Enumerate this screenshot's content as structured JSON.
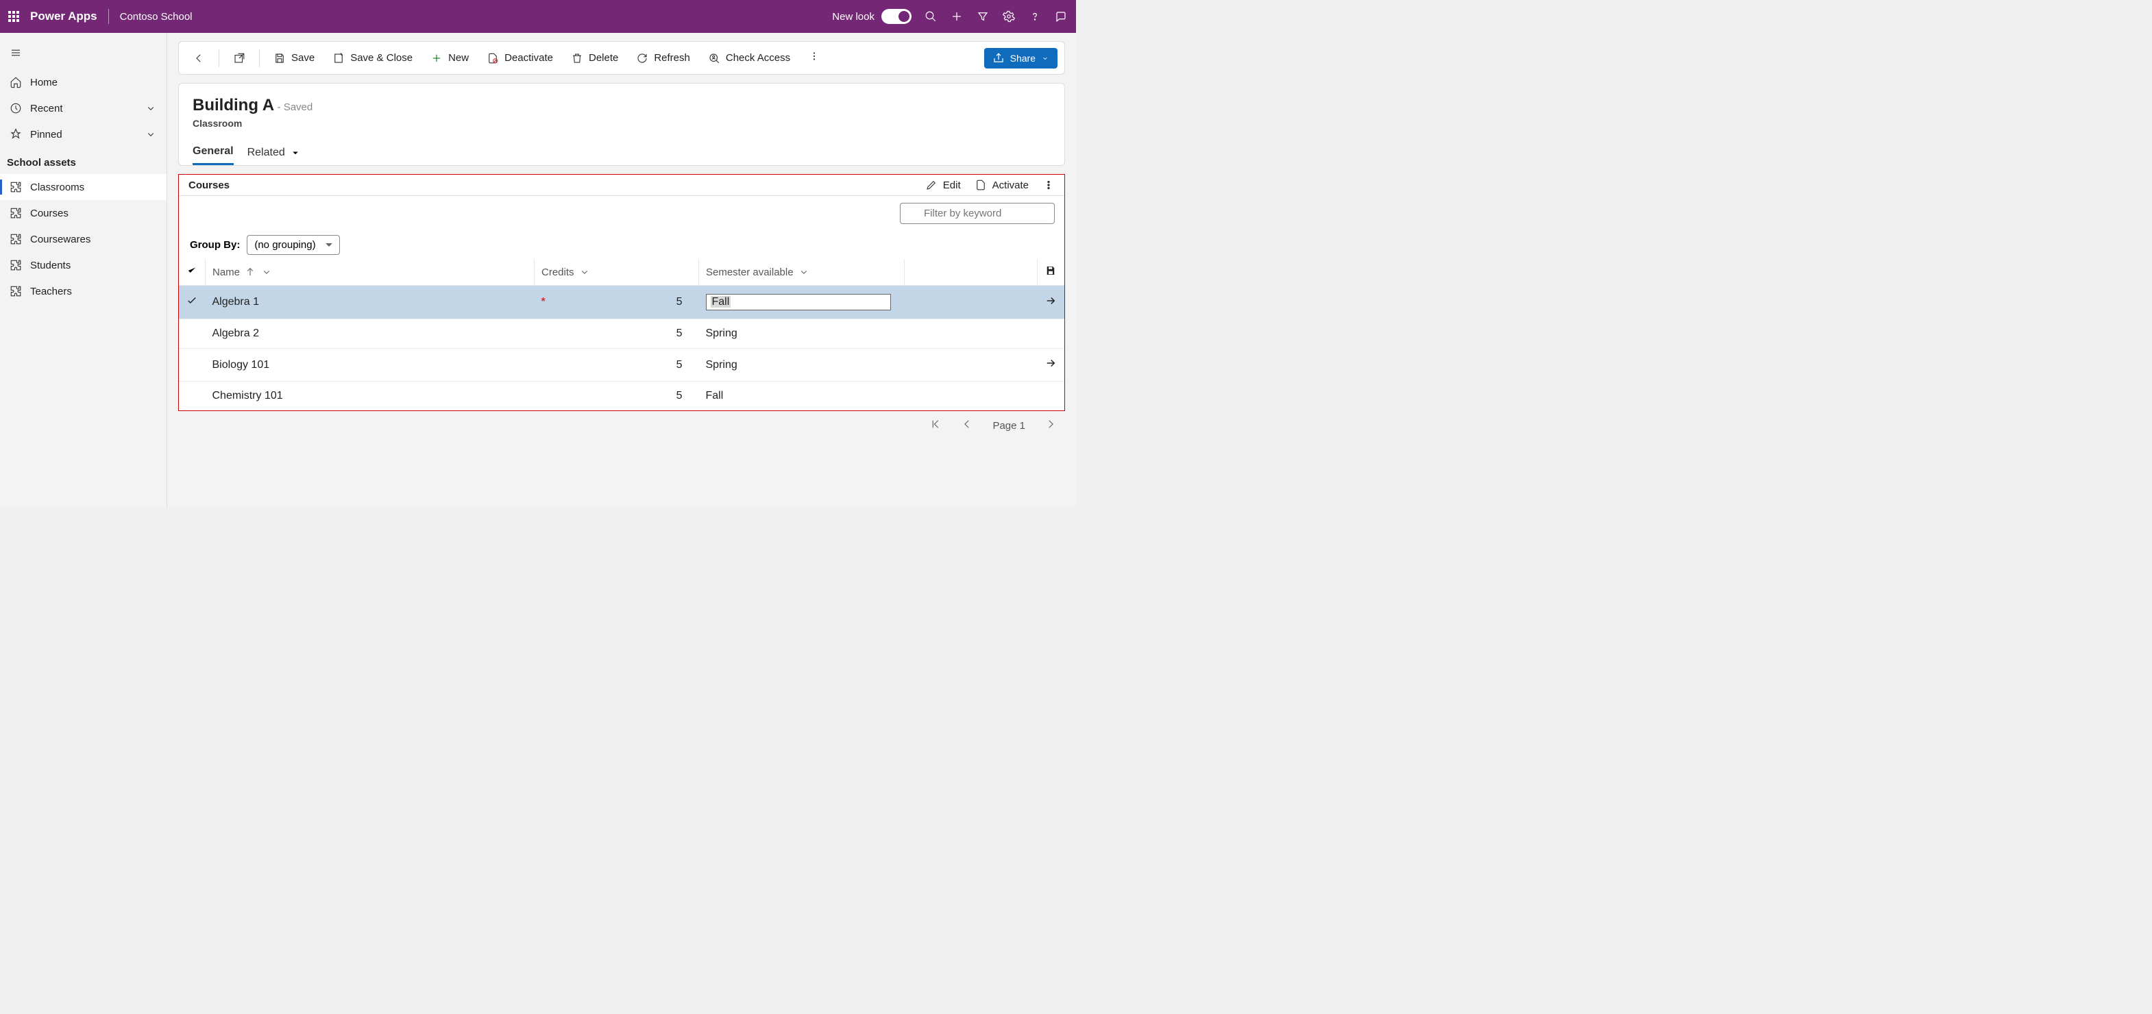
{
  "header": {
    "brand": "Power Apps",
    "org": "Contoso School",
    "new_look_label": "New look"
  },
  "sidebar": {
    "home": "Home",
    "recent": "Recent",
    "pinned": "Pinned",
    "group_title": "School assets",
    "items": [
      "Classrooms",
      "Courses",
      "Coursewares",
      "Students",
      "Teachers"
    ]
  },
  "commands": {
    "save": "Save",
    "save_close": "Save & Close",
    "new": "New",
    "deactivate": "Deactivate",
    "delete": "Delete",
    "refresh": "Refresh",
    "check_access": "Check Access",
    "share": "Share"
  },
  "record": {
    "title": "Building A",
    "saved": "- Saved",
    "entity": "Classroom",
    "tabs": {
      "general": "General",
      "related": "Related"
    }
  },
  "subgrid": {
    "title": "Courses",
    "edit": "Edit",
    "activate": "Activate",
    "filter_placeholder": "Filter by keyword",
    "groupby_label": "Group By:",
    "groupby_value": "(no grouping)",
    "columns": {
      "name": "Name",
      "credits": "Credits",
      "semester": "Semester available"
    },
    "edit_semester_value": "Fall",
    "rows": [
      {
        "name": "Algebra 1",
        "credits": "5",
        "semester": "Fall",
        "selected": true,
        "editing": true,
        "arrow": true,
        "required": true
      },
      {
        "name": "Algebra 2",
        "credits": "5",
        "semester": "Spring",
        "selected": false,
        "editing": false,
        "arrow": false
      },
      {
        "name": "Biology 101",
        "credits": "5",
        "semester": "Spring",
        "selected": false,
        "editing": false,
        "arrow": true
      },
      {
        "name": "Chemistry 101",
        "credits": "5",
        "semester": "Fall",
        "selected": false,
        "editing": false,
        "arrow": false
      }
    ]
  },
  "pager": {
    "page_label": "Page 1"
  }
}
